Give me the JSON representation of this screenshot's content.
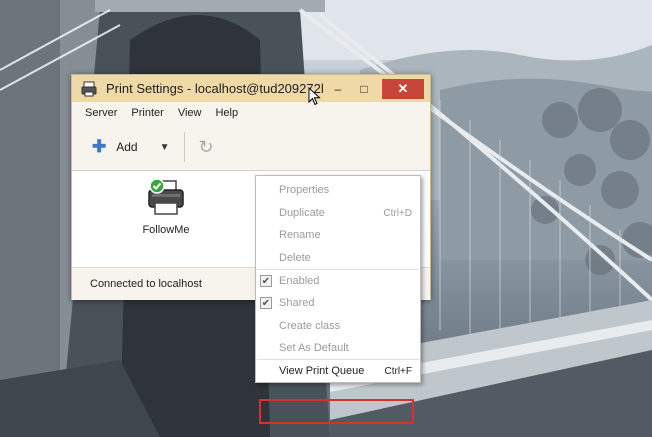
{
  "window": {
    "title": "Print Settings - localhost@tud209272l",
    "minimize_glyph": "–",
    "maximize_glyph": "□",
    "close_glyph": "✕"
  },
  "menubar": {
    "items": [
      "Server",
      "Printer",
      "View",
      "Help"
    ]
  },
  "toolbar": {
    "add_label": "Add",
    "add_icon": "plus-icon",
    "dropdown_icon": "triangle-down-icon",
    "refresh_icon": "refresh-icon"
  },
  "printers": [
    {
      "name": "FollowMe",
      "icon": "printer-default-icon"
    }
  ],
  "status": {
    "text": "Connected to localhost"
  },
  "context_menu": {
    "items": [
      {
        "label": "Properties",
        "shortcut": "",
        "enabled": false
      },
      {
        "label": "Duplicate",
        "shortcut": "Ctrl+D",
        "enabled": false
      },
      {
        "label": "Rename",
        "shortcut": "",
        "enabled": false
      },
      {
        "label": "Delete",
        "shortcut": "",
        "enabled": false
      },
      {
        "label": "Enabled",
        "shortcut": "",
        "enabled": false,
        "checked": true
      },
      {
        "label": "Shared",
        "shortcut": "",
        "enabled": false,
        "checked": true
      },
      {
        "label": "Create class",
        "shortcut": "",
        "enabled": false
      },
      {
        "label": "Set As Default",
        "shortcut": "",
        "enabled": false
      },
      {
        "label": "View Print Queue",
        "shortcut": "Ctrl+F",
        "enabled": true
      }
    ]
  },
  "colors": {
    "titlebar": "#efd9a6",
    "close_button": "#c8453b",
    "accent_blue": "#3d78c9",
    "highlight_red": "#d8312b"
  }
}
